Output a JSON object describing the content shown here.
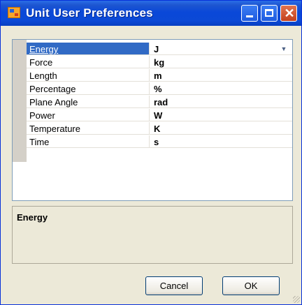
{
  "window": {
    "title": "Unit User Preferences",
    "title_icon": "app-icon",
    "buttons": [
      "minimize-icon",
      "maximize-icon",
      "close-icon"
    ]
  },
  "grid": {
    "rows": [
      {
        "name": "Energy",
        "value": "J",
        "selected": true
      },
      {
        "name": "Force",
        "value": "kg"
      },
      {
        "name": "Length",
        "value": "m"
      },
      {
        "name": "Percentage",
        "value": "%"
      },
      {
        "name": "Plane Angle",
        "value": "rad"
      },
      {
        "name": "Power",
        "value": "W"
      },
      {
        "name": "Temperature",
        "value": "K"
      },
      {
        "name": "Time",
        "value": "s"
      }
    ]
  },
  "help": {
    "title": "Energy"
  },
  "buttons": {
    "cancel": "Cancel",
    "ok": "OK"
  },
  "colors": {
    "title_bar": "#0a48d8",
    "selection": "#316ac5",
    "dialog_bg": "#ece9d8"
  }
}
